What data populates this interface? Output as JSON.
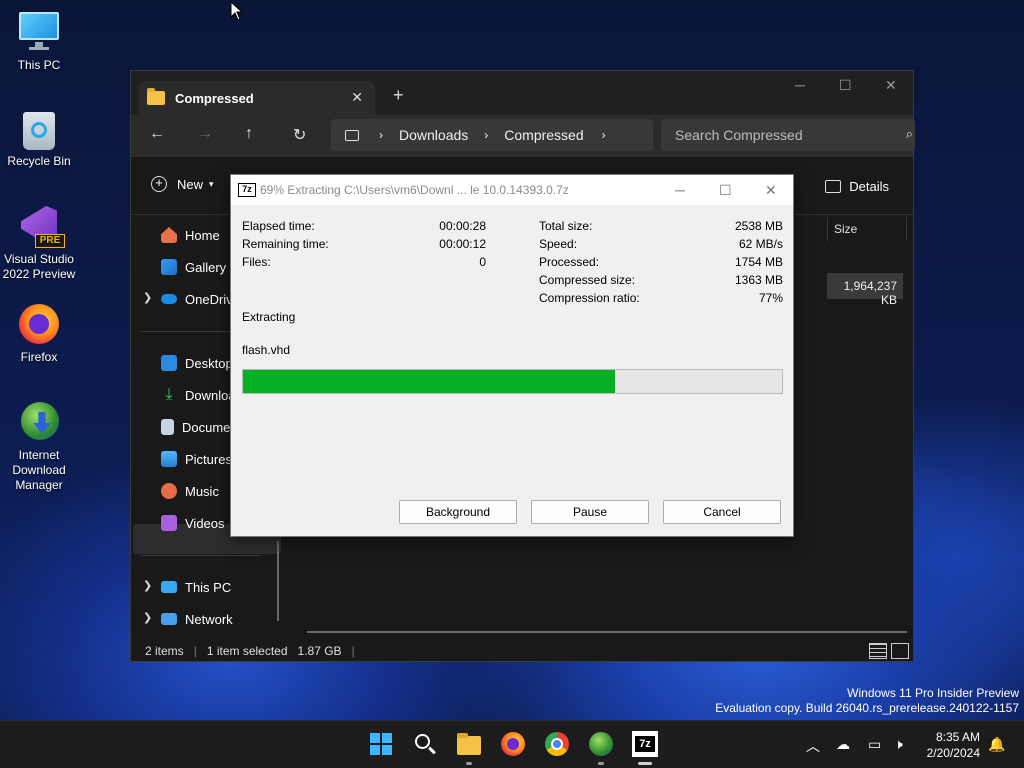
{
  "desktop": {
    "icons": [
      {
        "label": "This PC"
      },
      {
        "label": "Recycle Bin"
      },
      {
        "label": "Visual Studio 2022 Preview",
        "badge": "PRE"
      },
      {
        "label": "Firefox"
      },
      {
        "label": "Internet Download Manager"
      }
    ]
  },
  "explorer": {
    "tab_title": "Compressed",
    "breadcrumb": [
      "Downloads",
      "Compressed"
    ],
    "search_placeholder": "Search Compressed",
    "new_label": "New",
    "details_label": "Details",
    "column_size": "Size",
    "file_size": "1,964,237 KB",
    "sidebar": [
      "Home",
      "Gallery",
      "OneDrive",
      "Desktop",
      "Downloads",
      "Documents",
      "Pictures",
      "Music",
      "Videos",
      "This PC",
      "Network"
    ],
    "status": {
      "items": "2 items",
      "selected": "1 item selected",
      "size": "1.87 GB"
    }
  },
  "dialog": {
    "title": "69% Extracting C:\\Users\\vm6\\Downl ... le 10.0.14393.0.7z",
    "logo": "7z",
    "left_stats": [
      {
        "label": "Elapsed time:",
        "value": "00:00:28"
      },
      {
        "label": "Remaining time:",
        "value": "00:00:12"
      },
      {
        "label": "Files:",
        "value": "0"
      }
    ],
    "right_stats": [
      {
        "label": "Total size:",
        "value": "2538 MB"
      },
      {
        "label": "Speed:",
        "value": "62 MB/s"
      },
      {
        "label": "Processed:",
        "value": "1754 MB"
      },
      {
        "label": "Compressed size:",
        "value": "1363 MB"
      },
      {
        "label": "Compression ratio:",
        "value": "77%"
      }
    ],
    "operation": "Extracting",
    "current_file": "flash.vhd",
    "progress": 0.69,
    "buttons": {
      "background": "Background",
      "pause": "Pause",
      "cancel": "Cancel"
    }
  },
  "watermark": {
    "line1": "Windows 11 Pro Insider Preview",
    "line2": "Evaluation copy. Build 26040.rs_prerelease.240122-1157"
  },
  "taskbar": {
    "time": "8:35 AM",
    "date": "2/20/2024"
  },
  "colors": {
    "progress_fill": "#06b025",
    "accent": "#0067c0"
  }
}
